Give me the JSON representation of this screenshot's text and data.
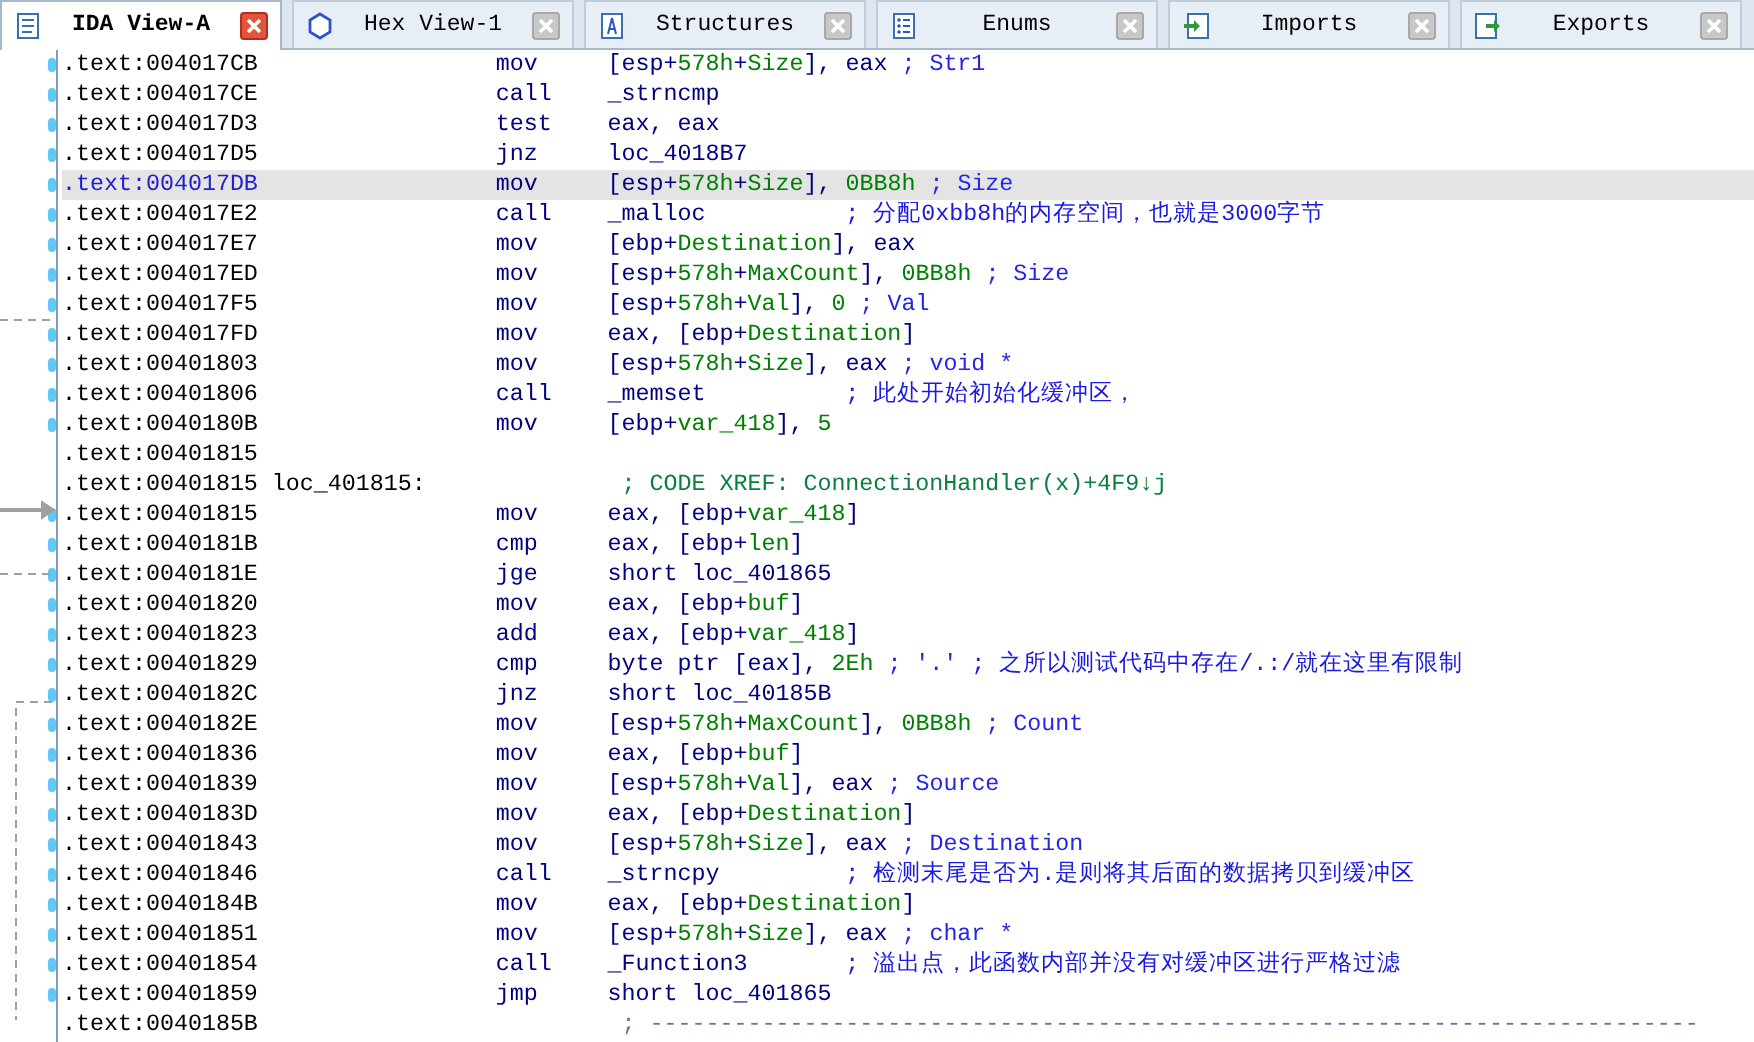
{
  "tabs": [
    {
      "label": "IDA View-A",
      "kind": "disasm",
      "selected": true
    },
    {
      "label": "Hex View-1",
      "kind": "hex",
      "selected": false
    },
    {
      "label": "Structures",
      "kind": "struct",
      "selected": false
    },
    {
      "label": "Enums",
      "kind": "enum",
      "selected": false
    },
    {
      "label": "Imports",
      "kind": "imports",
      "selected": false
    },
    {
      "label": "Exports",
      "kind": "exports",
      "selected": false
    }
  ],
  "lines": [
    {
      "address": ".text:004017CB",
      "mnemonic": "mov",
      "operand": "[esp+578h+Size], eax",
      "comments": [
        {
          "kind": "auto",
          "text": "; Str1"
        }
      ],
      "dot": true,
      "selected": false
    },
    {
      "address": ".text:004017CE",
      "mnemonic": "call",
      "operand": "_strncmp",
      "dot": true,
      "selected": false
    },
    {
      "address": ".text:004017D3",
      "mnemonic": "test",
      "operand": "eax, eax",
      "dot": true,
      "selected": false
    },
    {
      "address": ".text:004017D5",
      "mnemonic": "jnz",
      "operand": "loc_4018B7",
      "dot": true,
      "selected": false
    },
    {
      "address": ".text:004017DB",
      "mnemonic": "mov",
      "operand": "[esp+578h+Size], 0BB8h",
      "comments": [
        {
          "kind": "auto",
          "text": "; Size"
        }
      ],
      "dot": true,
      "selected": true
    },
    {
      "address": ".text:004017E2",
      "mnemonic": "call",
      "operand": "_malloc",
      "comments": [
        {
          "kind": "user",
          "text": "; 分配0xbb8h的内存空间，也就是3000字节"
        }
      ],
      "dot": true,
      "selected": false
    },
    {
      "address": ".text:004017E7",
      "mnemonic": "mov",
      "operand": "[ebp+Destination], eax",
      "dot": true,
      "selected": false
    },
    {
      "address": ".text:004017ED",
      "mnemonic": "mov",
      "operand": "[esp+578h+MaxCount], 0BB8h",
      "comments": [
        {
          "kind": "auto",
          "text": "; Size"
        }
      ],
      "dot": true,
      "selected": false
    },
    {
      "address": ".text:004017F5",
      "mnemonic": "mov",
      "operand": "[esp+578h+Val], 0",
      "comments": [
        {
          "kind": "auto",
          "text": "; Val"
        }
      ],
      "dot": true,
      "selected": false
    },
    {
      "address": ".text:004017FD",
      "mnemonic": "mov",
      "operand": "eax, [ebp+Destination]",
      "dot": true,
      "selected": false
    },
    {
      "address": ".text:00401803",
      "mnemonic": "mov",
      "operand": "[esp+578h+Size], eax",
      "comments": [
        {
          "kind": "auto",
          "text": "; void *"
        }
      ],
      "dot": true,
      "selected": false
    },
    {
      "address": ".text:00401806",
      "mnemonic": "call",
      "operand": "_memset",
      "comments": [
        {
          "kind": "user",
          "text": "; 此处开始初始化缓冲区，"
        }
      ],
      "dot": true,
      "selected": false
    },
    {
      "address": ".text:0040180B",
      "mnemonic": "mov",
      "operand": "[ebp+var_418], 5",
      "dot": true,
      "selected": false
    },
    {
      "address": ".text:00401815",
      "dot": false,
      "selected": false
    },
    {
      "address": ".text:00401815",
      "label": "loc_401815:",
      "comments": [
        {
          "kind": "xref",
          "text": "; CODE XREF: ConnectionHandler(x)+4F9↓j"
        }
      ],
      "dot": false,
      "selected": false
    },
    {
      "address": ".text:00401815",
      "mnemonic": "mov",
      "operand": "eax, [ebp+var_418]",
      "dot": true,
      "selected": false
    },
    {
      "address": ".text:0040181B",
      "mnemonic": "cmp",
      "operand": "eax, [ebp+len]",
      "dot": true,
      "selected": false
    },
    {
      "address": ".text:0040181E",
      "mnemonic": "jge",
      "operand": "short loc_401865",
      "dot": true,
      "selected": false
    },
    {
      "address": ".text:00401820",
      "mnemonic": "mov",
      "operand": "eax, [ebp+buf]",
      "dot": true,
      "selected": false
    },
    {
      "address": ".text:00401823",
      "mnemonic": "add",
      "operand": "eax, [ebp+var_418]",
      "dot": true,
      "selected": false
    },
    {
      "address": ".text:00401829",
      "mnemonic": "cmp",
      "operand": "byte ptr [eax], 2Eh",
      "comments": [
        {
          "kind": "auto",
          "text": "; '.'"
        },
        {
          "kind": "user",
          "text": "; 之所以测试代码中存在/.:/就在这里有限制"
        }
      ],
      "dot": true,
      "selected": false
    },
    {
      "address": ".text:0040182C",
      "mnemonic": "jnz",
      "operand": "short loc_40185B",
      "dot": true,
      "selected": false
    },
    {
      "address": ".text:0040182E",
      "mnemonic": "mov",
      "operand": "[esp+578h+MaxCount], 0BB8h",
      "comments": [
        {
          "kind": "auto",
          "text": "; Count"
        }
      ],
      "dot": true,
      "selected": false
    },
    {
      "address": ".text:00401836",
      "mnemonic": "mov",
      "operand": "eax, [ebp+buf]",
      "dot": true,
      "selected": false
    },
    {
      "address": ".text:00401839",
      "mnemonic": "mov",
      "operand": "[esp+578h+Val], eax",
      "comments": [
        {
          "kind": "auto",
          "text": "; Source"
        }
      ],
      "dot": true,
      "selected": false
    },
    {
      "address": ".text:0040183D",
      "mnemonic": "mov",
      "operand": "eax, [ebp+Destination]",
      "dot": true,
      "selected": false
    },
    {
      "address": ".text:00401843",
      "mnemonic": "mov",
      "operand": "[esp+578h+Size], eax",
      "comments": [
        {
          "kind": "auto",
          "text": "; Destination"
        }
      ],
      "dot": true,
      "selected": false
    },
    {
      "address": ".text:00401846",
      "mnemonic": "call",
      "operand": "_strncpy",
      "comments": [
        {
          "kind": "user",
          "text": "; 检测末尾是否为.是则将其后面的数据拷贝到缓冲区"
        }
      ],
      "dot": true,
      "selected": false
    },
    {
      "address": ".text:0040184B",
      "mnemonic": "mov",
      "operand": "eax, [ebp+Destination]",
      "dot": true,
      "selected": false
    },
    {
      "address": ".text:00401851",
      "mnemonic": "mov",
      "operand": "[esp+578h+Size], eax",
      "comments": [
        {
          "kind": "auto",
          "text": "; char *"
        }
      ],
      "dot": true,
      "selected": false
    },
    {
      "address": ".text:00401854",
      "mnemonic": "call",
      "operand": "_Function3",
      "comments": [
        {
          "kind": "user",
          "text": "; 溢出点，此函数内部并没有对缓冲区进行严格过滤"
        }
      ],
      "dot": true,
      "selected": false
    },
    {
      "address": ".text:00401859",
      "mnemonic": "jmp",
      "operand": "short loc_401865",
      "dot": true,
      "selected": false
    },
    {
      "address": ".text:0040185B",
      "comments": [
        {
          "kind": "separator",
          "text": "; ---------------------------------------------------------------------------"
        }
      ],
      "dot": false,
      "selected": false
    }
  ]
}
